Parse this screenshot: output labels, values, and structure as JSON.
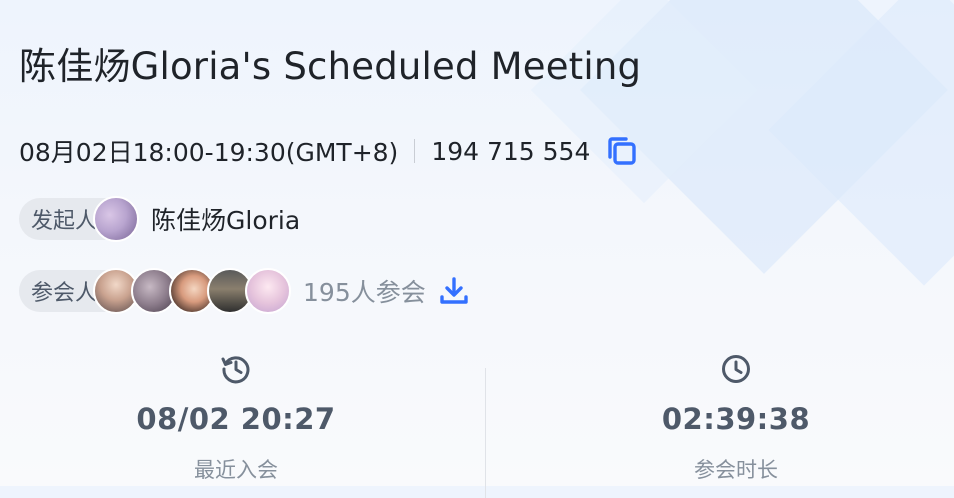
{
  "meeting": {
    "title": "陈佳炀Gloria's Scheduled Meeting",
    "time": "08月02日18:00-19:30(GMT+8)",
    "meeting_id": "194 715 554"
  },
  "host": {
    "role_label": "发起人",
    "name": "陈佳炀Gloria"
  },
  "participants": {
    "role_label": "参会人",
    "count_text": "195人参会"
  },
  "stats": {
    "recent_join": {
      "value": "08/02 20:27",
      "label": "最近入会",
      "icon": "history-icon"
    },
    "duration": {
      "value": "02:39:38",
      "label": "参会时长",
      "icon": "clock-icon"
    }
  },
  "colors": {
    "accent": "#3370ff",
    "text_primary": "#1f2329",
    "text_secondary": "#86909c",
    "chip_bg": "#e6e9ee"
  }
}
